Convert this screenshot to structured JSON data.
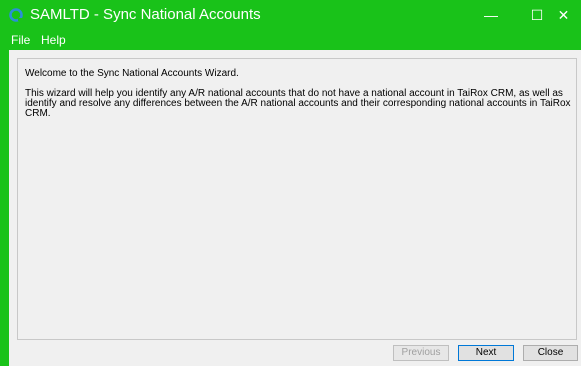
{
  "window": {
    "title": "SAMLTD - Sync National Accounts",
    "controls": {
      "minimize": "—",
      "maximize": "☐",
      "close": "✕"
    }
  },
  "menu": {
    "items": [
      {
        "label": "File"
      },
      {
        "label": "Help"
      }
    ]
  },
  "content": {
    "welcome": "Welcome to the Sync National Accounts Wizard.",
    "description": "This wizard will help you identify any A/R national accounts that do not have a national account in TaiRox CRM, as well as identify and resolve any differences between the A/R national accounts and their corresponding national accounts in TaiRox CRM."
  },
  "buttons": {
    "previous": "Previous",
    "next": "Next",
    "close": "Close",
    "previous_enabled": false
  },
  "colors": {
    "accent": "#19c219",
    "window_bg": "#f0f0f0",
    "focus_border": "#0078d7"
  },
  "icons": {
    "app": "app-logo-icon",
    "minimize": "minimize-icon",
    "maximize": "maximize-icon",
    "close": "close-icon"
  }
}
